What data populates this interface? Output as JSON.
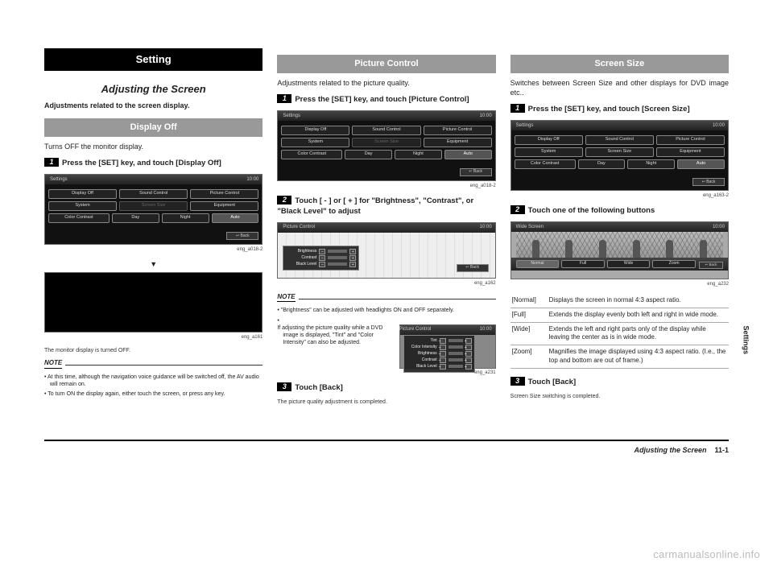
{
  "setting_header": "Setting",
  "adjusting_title": "Adjusting the Screen",
  "adjusting_sub": "Adjustments related to the screen display.",
  "display_off": {
    "head": "Display Off",
    "desc": "Turns OFF the monitor display.",
    "step1": "Press the [SET] key, and touch [Display Off]",
    "cap1": "eng_a018-2",
    "cap2": "eng_a161",
    "offline": "The monitor display is turned OFF.",
    "note_head": "NOTE",
    "note1": "At this time, although the navigation voice guidance will be switched off, the AV audio will remain on.",
    "note2": "To turn ON the display again, either touch the screen, or press any key."
  },
  "shot": {
    "title": "Settings",
    "time": "10:00",
    "b1": "Display Off",
    "b2": "Sound Control",
    "b3": "Picture Control",
    "b4": "System",
    "b5": "Screen Size",
    "b6": "Equipment",
    "cc": "Color Contrast",
    "day": "Day",
    "night": "Night",
    "auto": "Auto",
    "back": "↩ Back"
  },
  "picture": {
    "head": "Picture Control",
    "desc": "Adjustments related to the picture quality.",
    "step1": "Press the [SET] key, and touch [Picture Control]",
    "cap1": "eng_a018-2",
    "step2": "Touch [ - ] or [ + ] for \"Brightness\", \"Contrast\", or \"Black Level\" to adjust",
    "cap2": "eng_a162",
    "pc_title": "Picture Control",
    "r1": "Brightness",
    "r2": "Contrast",
    "r3": "Black Level",
    "note_head": "NOTE",
    "note1": "\"Brightness\" can be adjusted with headlights ON and OFF separately.",
    "note2a": "If adjusting the picture quality while a DVD image is displayed, \"Tint\" and \"Color Intensity\" can also be adjusted.",
    "cap3": "eng_a231",
    "pc2_r0": "Tint",
    "pc2_r1": "Color Intensity",
    "pc2_r2": "Brightness",
    "pc2_r3": "Contrast",
    "pc2_r4": "Black Level",
    "step3": "Touch [Back]",
    "done": "The picture quality adjustment is completed."
  },
  "screen": {
    "head": "Screen Size",
    "desc": "Switches between Screen Size and other displays for DVD image etc..",
    "step1": "Press the [SET] key, and touch [Screen Size]",
    "cap1": "eng_a163-2",
    "step2": "Touch one of the following buttons",
    "wide_title": "Wide Screen",
    "w1": "Normal",
    "w2": "Full",
    "w3": "Wide",
    "w4": "Zoom",
    "cap2": "eng_a232",
    "tbl": {
      "k1": "[Normal]",
      "v1": "Displays the screen in normal 4:3 aspect ratio.",
      "k2": "[Full]",
      "v2": "Extends the display evenly both left and right in wide mode.",
      "k3": "[Wide]",
      "v3": "Extends the left and right parts only of the display while leaving the center as is in wide mode.",
      "k4": "[Zoom]",
      "v4": "Magnifies the image displayed using 4:3 aspect ratio. (I.e., the top and bottom are out of frame.)"
    },
    "step3": "Touch [Back]",
    "done": "Screen Size switching is completed."
  },
  "side_label": "Settings",
  "footer": {
    "title": "Adjusting the Screen",
    "page": "11-1"
  },
  "watermark": "carmanualsonline.info",
  "glyph": {
    "minus": "–",
    "plus": "+",
    "tri": "▼"
  }
}
